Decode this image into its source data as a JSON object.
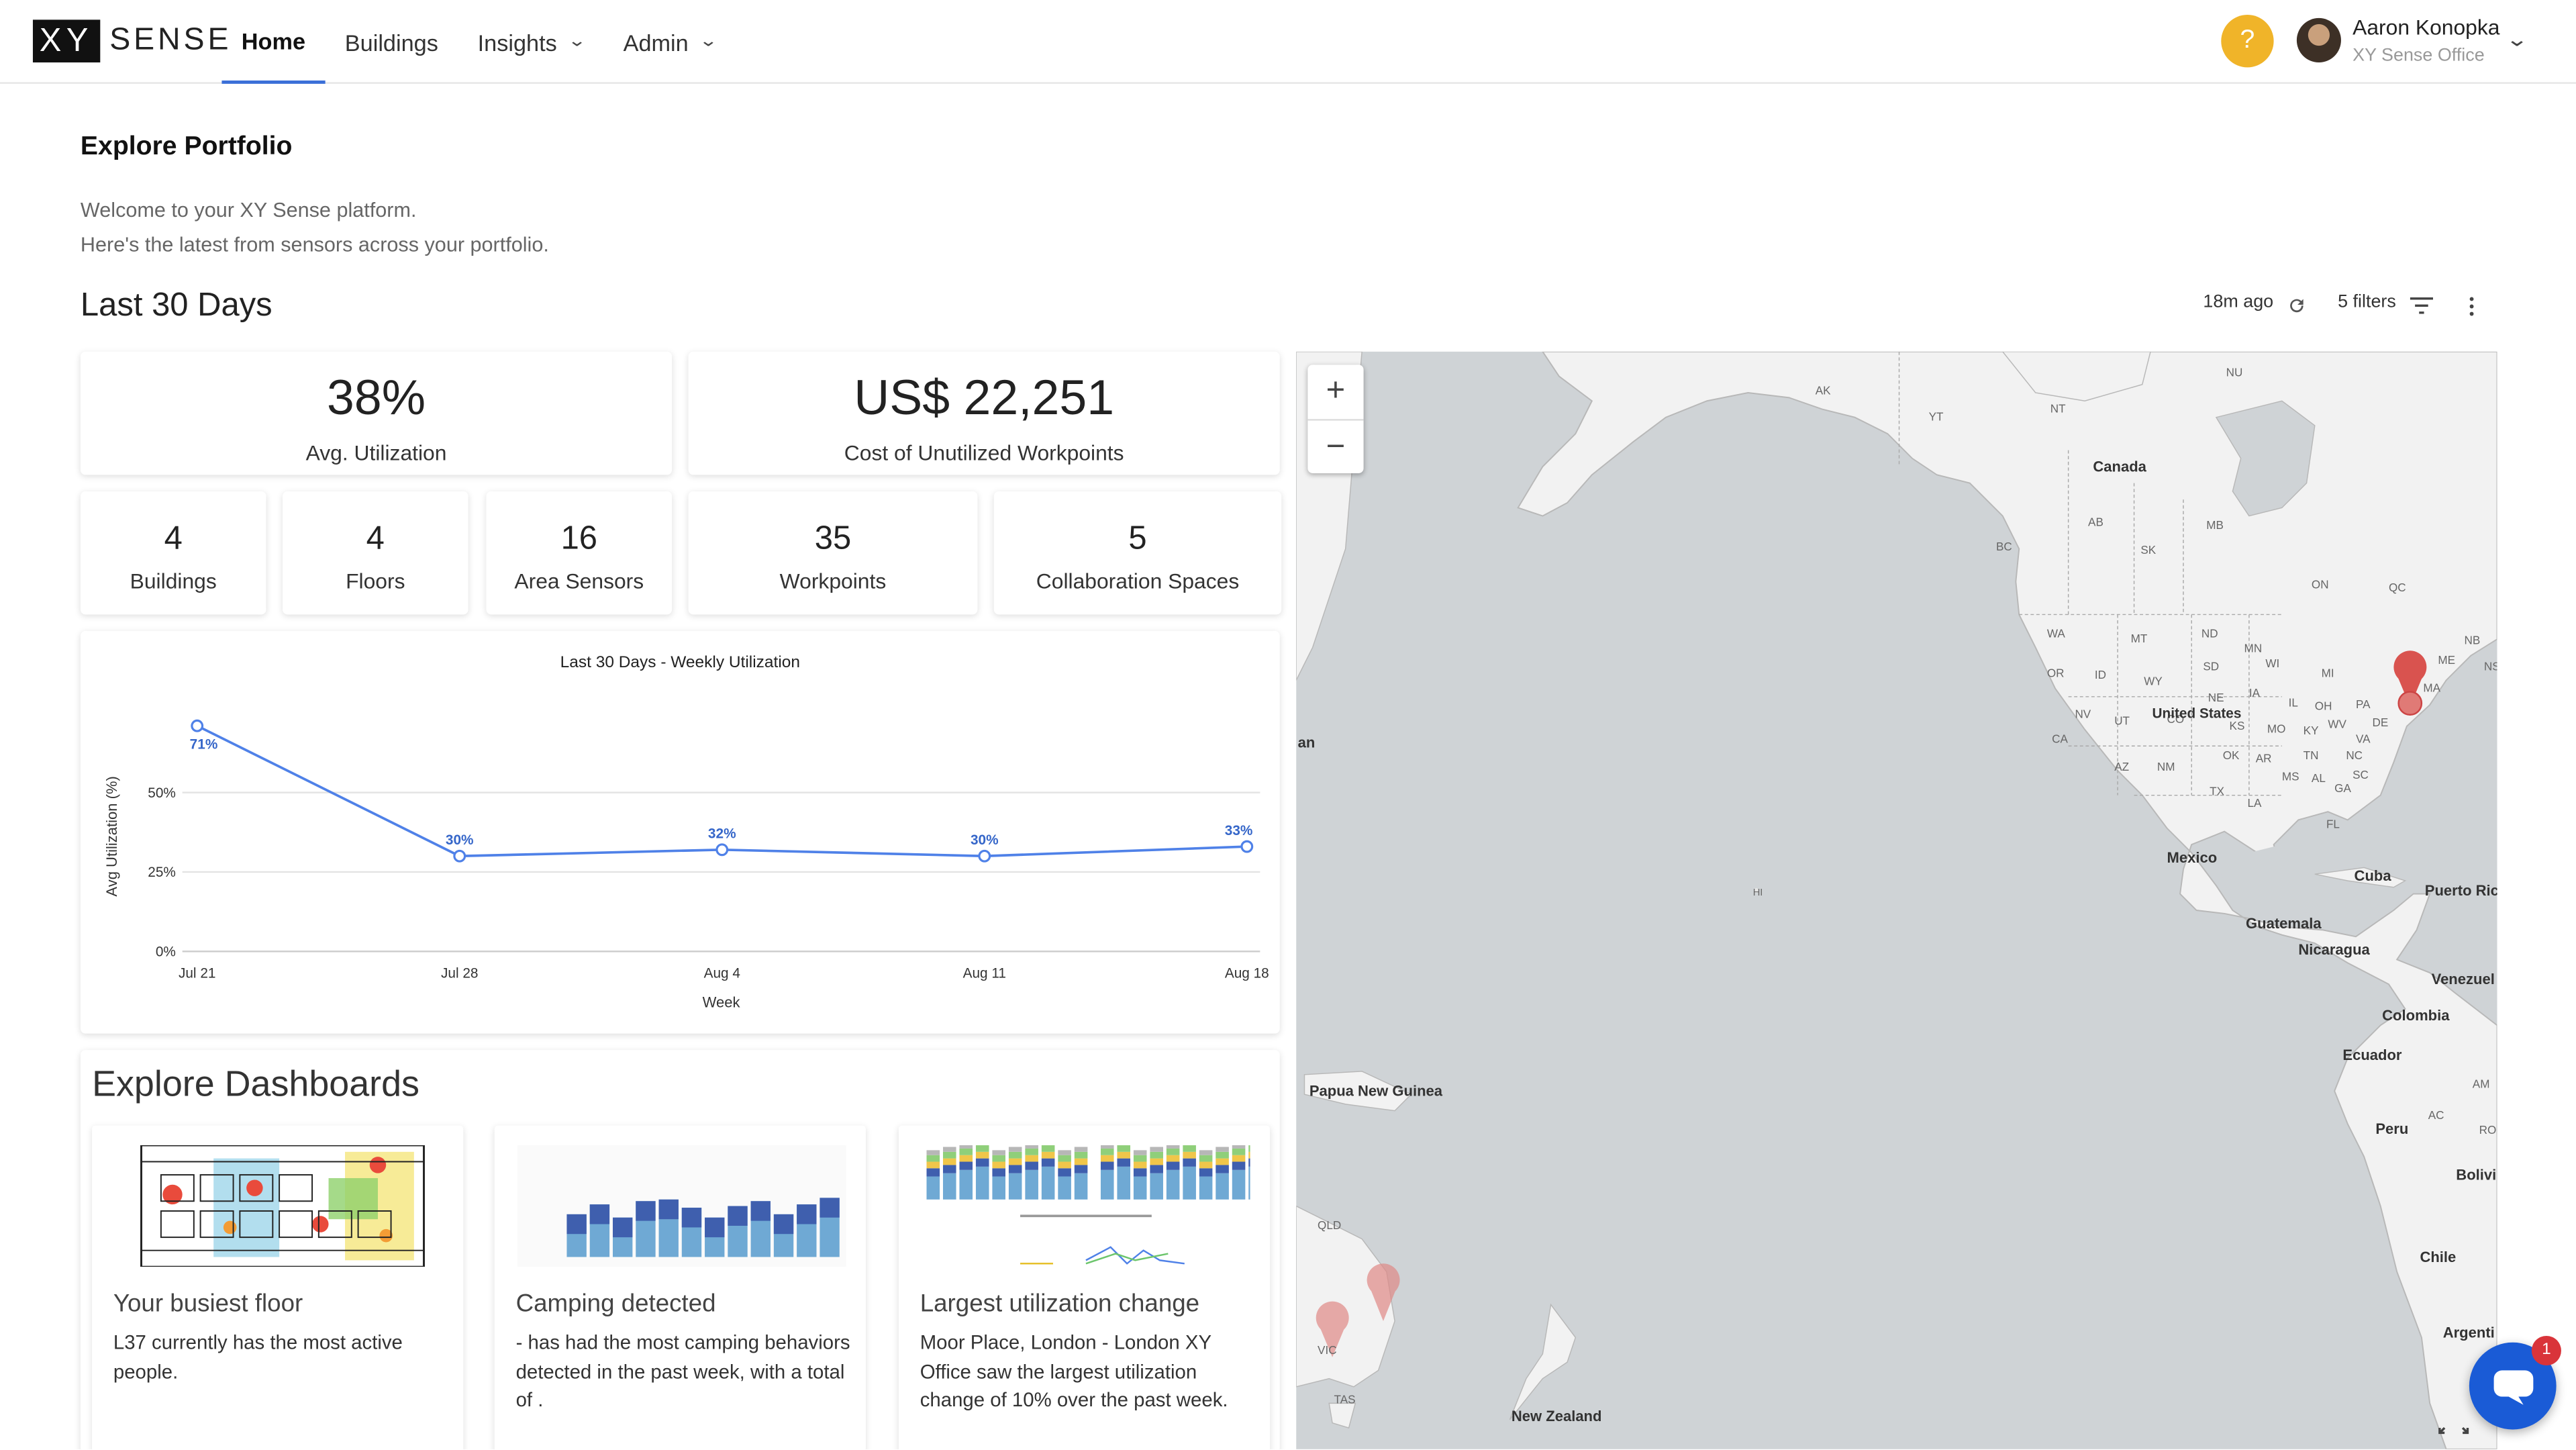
{
  "brand": {
    "logo_xy": "XY",
    "logo_sense": "SENSE"
  },
  "nav": {
    "items": [
      {
        "label": "Home",
        "active": true
      },
      {
        "label": "Buildings"
      },
      {
        "label": "Insights"
      },
      {
        "label": "Admin"
      }
    ]
  },
  "user": {
    "help": "?",
    "name": "Aaron Konopka",
    "org": "XY Sense Office"
  },
  "header": {
    "title": "Explore Portfolio",
    "welcome_line1": "Welcome to your XY Sense platform.",
    "welcome_line2": "Here's the latest from sensors across your portfolio."
  },
  "period": {
    "title": "Last 30 Days",
    "updated": "18m ago",
    "filters": "5 filters"
  },
  "kpis": {
    "utilization": {
      "value": "38%",
      "label": "Avg. Utilization"
    },
    "cost": {
      "value": "US$ 22,251",
      "label": "Cost of Unutilized Workpoints"
    },
    "buildings": {
      "value": "4",
      "label": "Buildings"
    },
    "floors": {
      "value": "4",
      "label": "Floors"
    },
    "area_sensors": {
      "value": "16",
      "label": "Area Sensors"
    },
    "workpoints": {
      "value": "35",
      "label": "Workpoints"
    },
    "collab": {
      "value": "5",
      "label": "Collaboration Spaces"
    }
  },
  "chart_data": {
    "type": "line",
    "title": "Last 30 Days - Weekly Utilization",
    "xlabel": "Week",
    "ylabel": "Avg Utilization (%)",
    "categories": [
      "Jul 21",
      "Jul 28",
      "Aug 4",
      "Aug 11",
      "Aug 18"
    ],
    "values": [
      71,
      30,
      32,
      30,
      33
    ],
    "value_labels": [
      "71%",
      "30%",
      "32%",
      "30%",
      "33%"
    ],
    "yticks": [
      "0%",
      "25%",
      "50%"
    ],
    "ylim": [
      0,
      75
    ],
    "grid": true,
    "color": "#4f81e8"
  },
  "dashboards": {
    "title": "Explore Dashboards",
    "cards": [
      {
        "heading": "Your busiest floor",
        "text": "L37 currently has the most active people."
      },
      {
        "heading": "Camping detected",
        "text": "- has had the most camping behaviors detected in the past week, with a total of ."
      },
      {
        "heading": "Largest utilization change",
        "text": "Moor Place, London - London XY Office saw the largest utilization change of 10% over the past week."
      }
    ]
  },
  "map": {
    "zoom_in": "+",
    "zoom_out": "−",
    "labels": {
      "ak": "AK",
      "yt": "YT",
      "nt": "NT",
      "nu": "NU",
      "canada": "Canada",
      "bc": "BC",
      "ab": "AB",
      "sk": "SK",
      "mb": "MB",
      "on": "ON",
      "qc": "QC",
      "nb": "NB",
      "ns": "NS",
      "wa": "WA",
      "mt": "MT",
      "nd": "ND",
      "mn": "MN",
      "or": "OR",
      "id": "ID",
      "wy": "WY",
      "sd": "SD",
      "wi": "WI",
      "mi": "MI",
      "ne": "NE",
      "ia": "IA",
      "il": "IL",
      "oh": "OH",
      "pa": "PA",
      "nv": "NV",
      "ut": "UT",
      "co": "CO",
      "us": "United States",
      "ks": "KS",
      "mo": "MO",
      "ky": "KY",
      "wv": "WV",
      "va": "VA",
      "ca": "CA",
      "tn": "TN",
      "nc": "NC",
      "az": "AZ",
      "nm": "NM",
      "ok": "OK",
      "ar": "AR",
      "sc": "SC",
      "ms": "MS",
      "al": "AL",
      "ga": "GA",
      "tx": "TX",
      "la": "LA",
      "fl": "FL",
      "me": "ME",
      "de": "DE",
      "ma": "MA",
      "mexico": "Mexico",
      "cuba": "Cuba",
      "puerto_rico": "Puerto Ric",
      "guatemala": "Guatemala",
      "nicaragua": "Nicaragua",
      "venezuela": "Venezuel",
      "colombia": "Colombia",
      "ecuador": "Ecuador",
      "peru": "Peru",
      "bolivia": "Bolivi",
      "chile": "Chile",
      "argentina": "Argenti",
      "am": "AM",
      "ac": "AC",
      "ro": "RO",
      "hi": "HI",
      "an": "an",
      "png": "Papua New Guinea",
      "qld": "QLD",
      "vic": "VIC",
      "tas": "TAS",
      "nz": "New Zealand"
    }
  },
  "chat": {
    "badge": "1"
  }
}
